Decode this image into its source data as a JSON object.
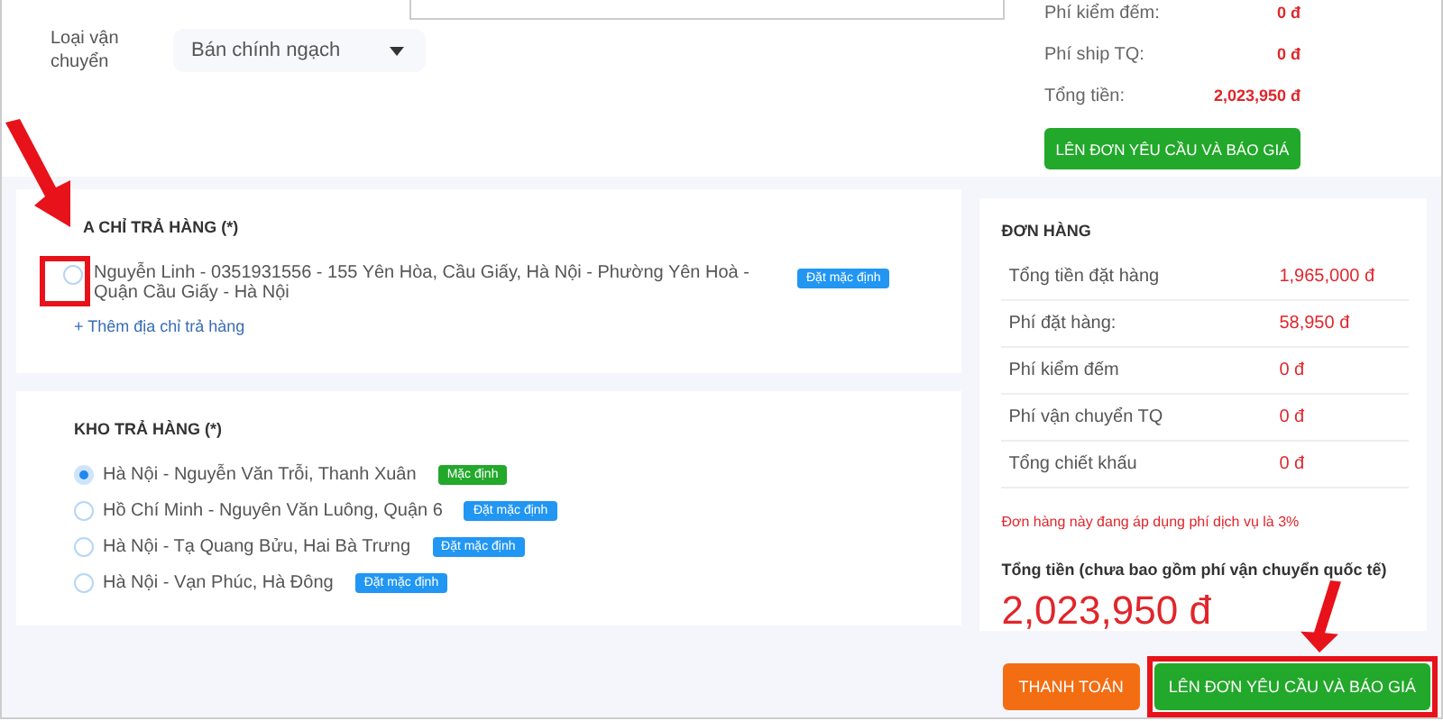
{
  "shipping": {
    "label": "Loại vận chuyển",
    "value": "Bán chính ngạch"
  },
  "summary_top": {
    "rows": [
      {
        "label": "Phí kiểm đếm:",
        "value": "0 đ"
      },
      {
        "label": "Phí ship TQ:",
        "value": "0 đ"
      },
      {
        "label": "Tổng tiền:",
        "value": "2,023,950 đ"
      }
    ],
    "button": "LÊN ĐƠN YÊU CẦU VÀ BÁO GIÁ"
  },
  "address": {
    "title": "A CHỈ TRẢ HÀNG (*)",
    "items": [
      {
        "text": "Nguyễn Linh - 0351931556 - 155 Yên Hòa, Cầu Giấy, Hà Nội - Phường Yên Hoà - Quận Cầu Giấy - Hà Nội",
        "selected": false,
        "badge": "Đặt mặc định",
        "kind": "action"
      }
    ],
    "add_link": "+ Thêm địa chỉ trả hàng"
  },
  "warehouse": {
    "title": "KHO TRẢ HÀNG (*)",
    "items": [
      {
        "text": "Hà Nội - Nguyễn Văn Trỗi, Thanh Xuân",
        "selected": true,
        "badge": "Mặc định",
        "kind": "current"
      },
      {
        "text": "Hồ Chí Minh - Nguyên Văn Luông, Quận 6",
        "selected": false,
        "badge": "Đặt mặc định",
        "kind": "action"
      },
      {
        "text": "Hà Nội - Tạ Quang Bửu, Hai Bà Trưng",
        "selected": false,
        "badge": "Đặt mặc định",
        "kind": "action"
      },
      {
        "text": "Hà Nội - Vạn Phúc, Hà Đông",
        "selected": false,
        "badge": "Đặt mặc định",
        "kind": "action"
      }
    ]
  },
  "order": {
    "title": "ĐƠN HÀNG",
    "rows": [
      {
        "label": "Tổng tiền đặt hàng",
        "value": "1,965,000 đ"
      },
      {
        "label": "Phí đặt hàng:",
        "value": "58,950 đ"
      },
      {
        "label": "Phí kiểm đếm",
        "value": "0 đ"
      },
      {
        "label": "Phí vận chuyển TQ",
        "value": "0 đ"
      },
      {
        "label": "Tổng chiết khấu",
        "value": "0 đ"
      }
    ],
    "note": "Đơn hàng này đang áp dụng phí dịch vụ là 3%",
    "total_label": "Tổng tiền (chưa bao gồm phí vận chuyển quốc tế)",
    "total_value": "2,023,950 đ"
  },
  "actions": [
    {
      "label": "THANH TOÁN",
      "kind": "pay"
    },
    {
      "label": "LÊN ĐƠN YÊU CẦU VÀ BÁO GIÁ",
      "kind": "quote"
    }
  ]
}
